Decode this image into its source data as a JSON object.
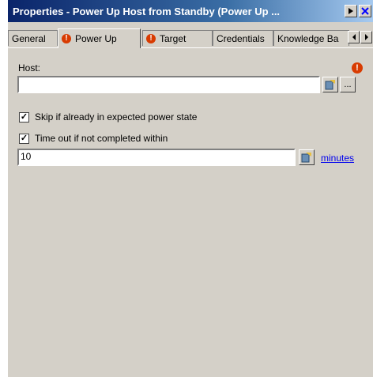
{
  "window": {
    "title": "Properties - Power Up Host from Standby (Power Up ...",
    "help_icon": "question-arrow-icon",
    "close_icon": "close-x-icon"
  },
  "tabs": [
    {
      "label": "General",
      "warning": false
    },
    {
      "label": "Power Up",
      "warning": true,
      "active": true
    },
    {
      "label": "Target",
      "warning": true
    },
    {
      "label": "Credentials",
      "warning": false
    },
    {
      "label": "Knowledge Ba",
      "warning": false
    }
  ],
  "host": {
    "label": "Host:",
    "value": "",
    "warning_icon": "error-icon",
    "browse_label": "..."
  },
  "skip_option": {
    "label": "Skip if already in expected power state",
    "checked": true
  },
  "timeout_option": {
    "label": "Time out if not completed within",
    "checked": true,
    "value": "10",
    "unit_link": "minutes"
  },
  "colors": {
    "dialog_bg": "#d4d0c8",
    "title_start": "#0a246a",
    "title_end": "#a6caf0",
    "warning": "#d83b01",
    "link": "#0000ee"
  }
}
